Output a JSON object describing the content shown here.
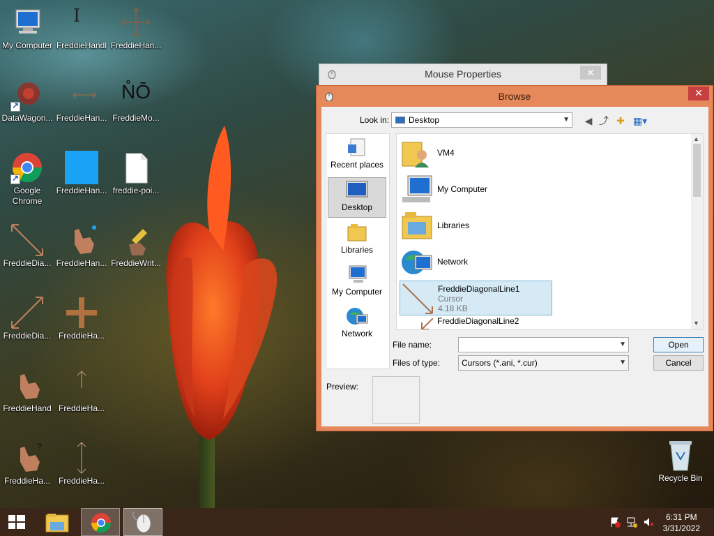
{
  "desktop": {
    "icons": [
      {
        "label": "My Computer"
      },
      {
        "label": "FreddieHandl"
      },
      {
        "label": "FreddieHan..."
      },
      {
        "label": "DataWagon..."
      },
      {
        "label": "FreddieHan..."
      },
      {
        "label": "FreddieMo..."
      },
      {
        "label": "Google Chrome"
      },
      {
        "label": "FreddieHan..."
      },
      {
        "label": "freddie-poi..."
      },
      {
        "label": "FreddieDia..."
      },
      {
        "label": "FreddieHan..."
      },
      {
        "label": "FreddieWrit..."
      },
      {
        "label": "FreddieDia..."
      },
      {
        "label": "FreddieHa..."
      },
      {
        "label": "FreddieHand"
      },
      {
        "label": "FreddieHa..."
      },
      {
        "label": "FreddieHa..."
      },
      {
        "label": "FreddieHa..."
      }
    ],
    "recycle_bin": "Recycle Bin"
  },
  "mouse_properties": {
    "title": "Mouse Properties",
    "close": "✕"
  },
  "browse": {
    "title": "Browse",
    "close": "✕",
    "look_in_label": "Look in:",
    "look_in_value": "Desktop",
    "places": [
      "Recent places",
      "Desktop",
      "Libraries",
      "My Computer",
      "Network"
    ],
    "files": [
      {
        "name": "VM4"
      },
      {
        "name": "My Computer"
      },
      {
        "name": "Libraries"
      },
      {
        "name": "Network"
      },
      {
        "name": "FreddieDiagonalLine1",
        "type": "Cursor",
        "size": "4.18 KB"
      },
      {
        "name": "FreddieDiagonalLine2"
      }
    ],
    "file_name_label": "File name:",
    "file_name_value": "",
    "files_of_type_label": "Files of type:",
    "files_of_type_value": "Cursors (*.ani, *.cur)",
    "open_label": "Open",
    "cancel_label": "Cancel",
    "preview_label": "Preview:"
  },
  "taskbar": {
    "time": "6:31 PM",
    "date": "3/31/2022"
  }
}
